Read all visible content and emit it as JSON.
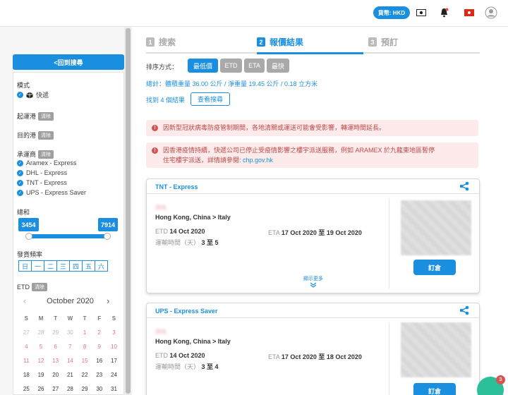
{
  "topbar": {
    "currency_label": "貨幣: HKD",
    "icons": [
      "money-icon",
      "bell-icon",
      "hk-flag-icon",
      "user-avatar-icon"
    ]
  },
  "sidebar": {
    "back_label": "<回到搜尋",
    "mode_label": "模式",
    "mode_value": "快遞",
    "origin_label": "起運港",
    "dest_label": "目的港",
    "carrier_label": "承運商",
    "clear_label": "清除",
    "carriers": [
      "Aramex - Express",
      "DHL - Express",
      "TNT - Express",
      "UPS - Express Saver"
    ],
    "total_label": "總和",
    "range_min": "3454",
    "range_max": "7914",
    "freq_label": "發貨頻率",
    "days": [
      "日",
      "一",
      "二",
      "三",
      "四",
      "五",
      "六"
    ],
    "etd_label": "ETD"
  },
  "calendar": {
    "month": "October 2020",
    "prev": "‹",
    "next": "›",
    "dow": [
      "S",
      "M",
      "T",
      "W",
      "T",
      "F",
      "S"
    ],
    "weeks": [
      [
        "27",
        "28",
        "29",
        "30",
        "1",
        "2",
        "3"
      ],
      [
        "4",
        "5",
        "6",
        "7",
        "8",
        "9",
        "10"
      ],
      [
        "11",
        "12",
        "13",
        "14",
        "15",
        "16",
        "17"
      ],
      [
        "18",
        "19",
        "20",
        "21",
        "22",
        "23",
        "24"
      ],
      [
        "25",
        "26",
        "27",
        "28",
        "29",
        "30",
        "31"
      ]
    ]
  },
  "steps": [
    {
      "num": "1",
      "label": "搜索"
    },
    {
      "num": "2",
      "label": "報價結果"
    },
    {
      "num": "3",
      "label": "預訂"
    }
  ],
  "sort": {
    "label": "排序方式：",
    "options": [
      "最低價",
      "ETD",
      "ETA",
      "最快"
    ]
  },
  "summary": {
    "totals": "總計：體積重量 36.00 公斤 / 淨重量 19.45 公斤 / 0.18 立方米",
    "found": "找到 4 個結果",
    "search_again": "查看搜尋"
  },
  "alerts": [
    {
      "text": "因新型冠狀病毒防疫管制期間，各地清關或運送可能會受影響，轉運時間延長。"
    },
    {
      "text_line1": "因香港疫情持續，快遞公司已停止受疫情影響之樓宇派送服務，例如 ARAMEX 於九龍東地區暫停",
      "text_line2": "住宅樓宇派送，詳情請參閱:",
      "link": "chp.gov.hk"
    }
  ],
  "cards": [
    {
      "title": "TNT - Express",
      "blurred": "價格",
      "route": "Hong Kong, China > Italy",
      "etd_label": "ETD",
      "etd": "14 Oct 2020",
      "eta_label": "ETA",
      "eta": "17 Oct 2020 至 19 Oct 2020",
      "transit_label": "運輸時間（天）",
      "transit": "3 至 5",
      "order_label": "訂倉",
      "more_label": "顯示更多"
    },
    {
      "title": "UPS - Express Saver",
      "blurred": "價格",
      "route": "Hong Kong, China > Italy",
      "etd_label": "ETD",
      "etd": "14 Oct 2020",
      "eta_label": "ETA",
      "eta": "17 Oct 2020 至 18 Oct 2020",
      "transit_label": "運輸時間（天）",
      "transit": "3 至 4",
      "order_label": "訂倉"
    }
  ],
  "chat": {
    "badge": "3"
  },
  "colors": {
    "accent": "#1a8fe0",
    "disabled_sort": "#a9a9a9",
    "alert_bg": "#fdeaea",
    "alert_icon": "#d9534f"
  }
}
